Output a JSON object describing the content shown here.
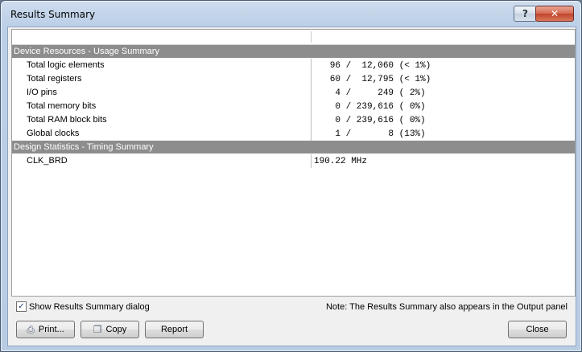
{
  "window": {
    "title": "Results Summary",
    "help_glyph": "?",
    "close_glyph": "✕"
  },
  "sections": [
    {
      "title": "Device Resources - Usage Summary",
      "rows": [
        {
          "label": "Total logic elements",
          "value": "   96 /  12,060 (< 1%)"
        },
        {
          "label": "Total registers",
          "value": "   60 /  12,795 (< 1%)"
        },
        {
          "label": "I/O pins",
          "value": "    4 /     249 ( 2%)"
        },
        {
          "label": "Total memory bits",
          "value": "    0 / 239,616 ( 0%)"
        },
        {
          "label": "Total RAM block bits",
          "value": "    0 / 239,616 ( 0%)"
        },
        {
          "label": "Global clocks",
          "value": "    1 /       8 (13%)"
        }
      ]
    },
    {
      "title": "Design Statistics - Timing Summary",
      "rows": [
        {
          "label": "CLK_BRD",
          "value": "190.22 MHz"
        }
      ]
    }
  ],
  "footer": {
    "show_dialog_label": "Show Results Summary dialog",
    "show_dialog_checked": true,
    "checkmark": "✓",
    "note": "Note: The Results Summary also appears in the Output panel"
  },
  "buttons": {
    "print": {
      "label": "Print...",
      "icon": "printer-icon",
      "glyph": "⎙"
    },
    "copy": {
      "label": "Copy",
      "icon": "copy-icon",
      "glyph": "❐"
    },
    "report": {
      "label": "Report"
    },
    "close": {
      "label": "Close"
    }
  }
}
